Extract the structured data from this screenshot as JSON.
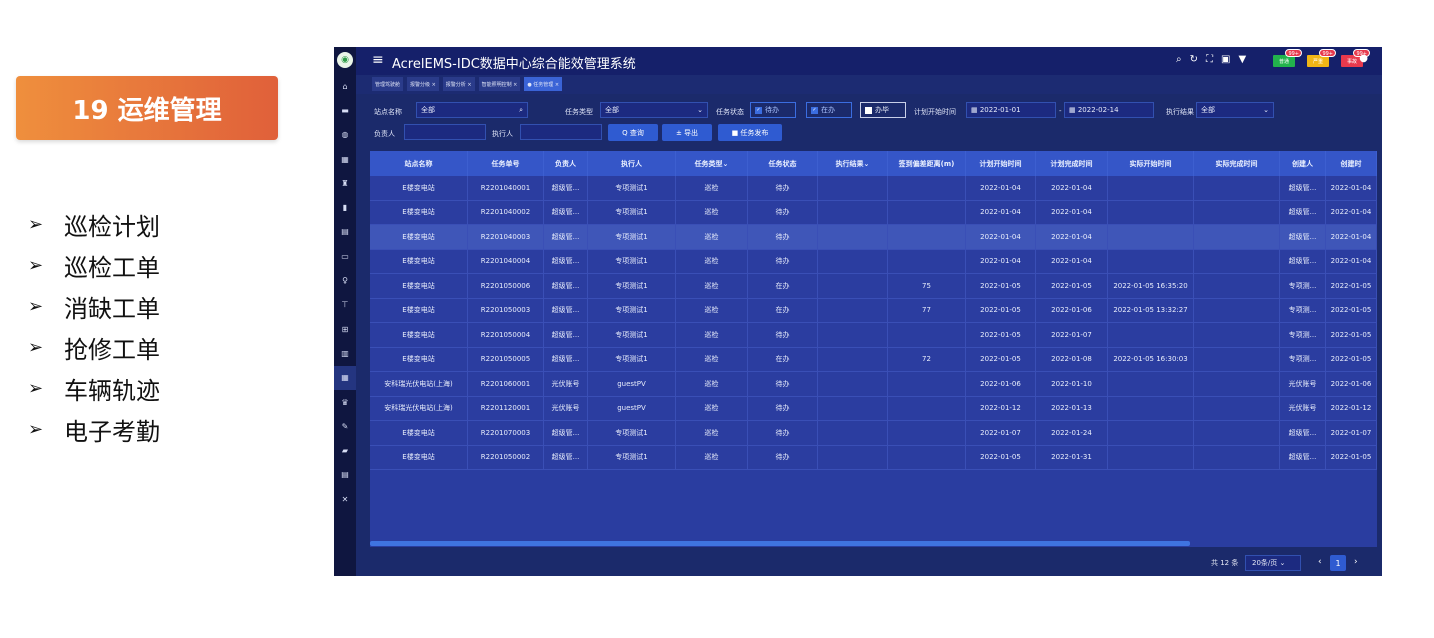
{
  "slide": {
    "title": "19 运维管理",
    "bullets": [
      "巡检计划",
      "巡检工单",
      "消缺工单",
      "抢修工单",
      "车辆轨迹",
      "电子考勤"
    ]
  },
  "app": {
    "title": "AcrelEMS-IDC数据中心综合能效管理系统",
    "alerts": [
      {
        "label": "普通",
        "count": "99+",
        "color": "#22b24c"
      },
      {
        "label": "严重",
        "count": "99+",
        "color": "#f0b616"
      },
      {
        "label": "事故",
        "count": "99+",
        "color": "#e8394d"
      }
    ],
    "tabs": [
      "管理驾驶舱",
      "报警分级 ×",
      "报警分析 ×",
      "智能照明控制 ×",
      "● 任务管理 ×"
    ],
    "filters": {
      "station_label": "站点名称",
      "station_value": "全部",
      "task_type_label": "任务类型",
      "task_type_value": "全部",
      "task_status_label": "任务状态",
      "status_pending": "待办",
      "status_doing": "在办",
      "status_done": "办毕",
      "plan_start_label": "计划开始时间",
      "date_from": "2022-01-01",
      "date_sep": "-",
      "date_to": "2022-02-14",
      "result_label": "执行结果",
      "result_value": "全部",
      "owner_label": "负责人",
      "executor_label": "执行人",
      "query_btn": "Q 查询",
      "export_btn": "± 导出",
      "publish_btn": "■ 任务发布"
    },
    "columns": [
      "站点名称",
      "任务单号",
      "负责人",
      "执行人",
      "任务类型⌄",
      "任务状态",
      "执行结果⌄",
      "签到偏差距离(m)",
      "计划开始时间",
      "计划完成时间",
      "实际开始时间",
      "实际完成时间",
      "创建人",
      "创建时"
    ],
    "rows": [
      [
        "E楼变电站",
        "R2201040001",
        "超级管...",
        "专项测试1",
        "巡检",
        "待办",
        "",
        "",
        "2022-01-04",
        "2022-01-04",
        "",
        "",
        "超级管...",
        "2022-01-04"
      ],
      [
        "E楼变电站",
        "R2201040002",
        "超级管...",
        "专项测试1",
        "巡检",
        "待办",
        "",
        "",
        "2022-01-04",
        "2022-01-04",
        "",
        "",
        "超级管...",
        "2022-01-04"
      ],
      [
        "E楼变电站",
        "R2201040003",
        "超级管...",
        "专项测试1",
        "巡检",
        "待办",
        "",
        "",
        "2022-01-04",
        "2022-01-04",
        "",
        "",
        "超级管...",
        "2022-01-04"
      ],
      [
        "E楼变电站",
        "R2201040004",
        "超级管...",
        "专项测试1",
        "巡检",
        "待办",
        "",
        "",
        "2022-01-04",
        "2022-01-04",
        "",
        "",
        "超级管...",
        "2022-01-04"
      ],
      [
        "E楼变电站",
        "R2201050006",
        "超级管...",
        "专项测试1",
        "巡检",
        "在办",
        "",
        "75",
        "2022-01-05",
        "2022-01-05",
        "2022-01-05 16:35:20",
        "",
        "专项测...",
        "2022-01-05"
      ],
      [
        "E楼变电站",
        "R2201050003",
        "超级管...",
        "专项测试1",
        "巡检",
        "在办",
        "",
        "77",
        "2022-01-05",
        "2022-01-06",
        "2022-01-05 13:32:27",
        "",
        "专项测...",
        "2022-01-05"
      ],
      [
        "E楼变电站",
        "R2201050004",
        "超级管...",
        "专项测试1",
        "巡检",
        "待办",
        "",
        "",
        "2022-01-05",
        "2022-01-07",
        "",
        "",
        "专项测...",
        "2022-01-05"
      ],
      [
        "E楼变电站",
        "R2201050005",
        "超级管...",
        "专项测试1",
        "巡检",
        "在办",
        "",
        "72",
        "2022-01-05",
        "2022-01-08",
        "2022-01-05 16:30:03",
        "",
        "专项测...",
        "2022-01-05"
      ],
      [
        "安科瑞光伏电站(上海)",
        "R2201060001",
        "光伏账号",
        "guestPV",
        "巡检",
        "待办",
        "",
        "",
        "2022-01-06",
        "2022-01-10",
        "",
        "",
        "光伏账号",
        "2022-01-06"
      ],
      [
        "安科瑞光伏电站(上海)",
        "R2201120001",
        "光伏账号",
        "guestPV",
        "巡检",
        "待办",
        "",
        "",
        "2022-01-12",
        "2022-01-13",
        "",
        "",
        "光伏账号",
        "2022-01-12"
      ],
      [
        "E楼变电站",
        "R2201070003",
        "超级管...",
        "专项测试1",
        "巡检",
        "待办",
        "",
        "",
        "2022-01-07",
        "2022-01-24",
        "",
        "",
        "超级管...",
        "2022-01-07"
      ],
      [
        "E楼变电站",
        "R2201050002",
        "超级管...",
        "专项测试1",
        "巡检",
        "待办",
        "",
        "",
        "2022-01-05",
        "2022-01-31",
        "",
        "",
        "超级管...",
        "2022-01-05"
      ]
    ],
    "pager": {
      "total": "共 12 条",
      "page_size": "20条/页 ⌄",
      "prev": "‹",
      "page": "1",
      "next": "›"
    }
  }
}
